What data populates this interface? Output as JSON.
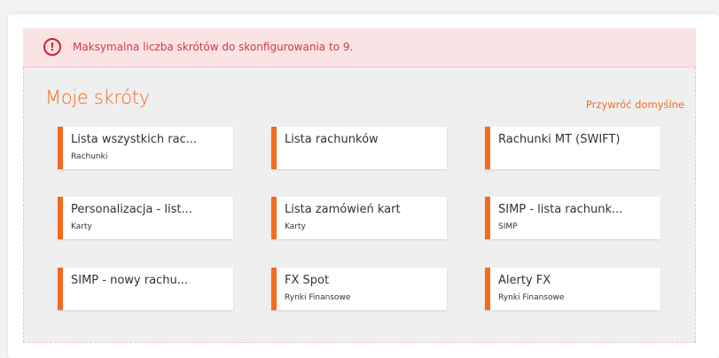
{
  "alert": {
    "icon": "exclamation-circle-icon",
    "text": "Maksymalna liczba skrótów do skonfigurowania to 9."
  },
  "shortcuts": {
    "title": "Moje skróty",
    "restore_label": "Przywróć domyślne",
    "accent_color": "#f26b21",
    "items": [
      {
        "title": "Lista wszystkich rac...",
        "subtitle": "Rachunki"
      },
      {
        "title": "Lista rachunków",
        "subtitle": ""
      },
      {
        "title": "Rachunki MT (SWIFT)",
        "subtitle": ""
      },
      {
        "title": "Personalizacja - list...",
        "subtitle": "Karty"
      },
      {
        "title": "Lista zamówień kart",
        "subtitle": "Karty"
      },
      {
        "title": "SIMP - lista rachunk...",
        "subtitle": "SIMP"
      },
      {
        "title": "SIMP - nowy rachu...",
        "subtitle": ""
      },
      {
        "title": "FX Spot",
        "subtitle": "Rynki Finansowe"
      },
      {
        "title": "Alerty FX",
        "subtitle": "Rynki Finansowe"
      }
    ]
  }
}
